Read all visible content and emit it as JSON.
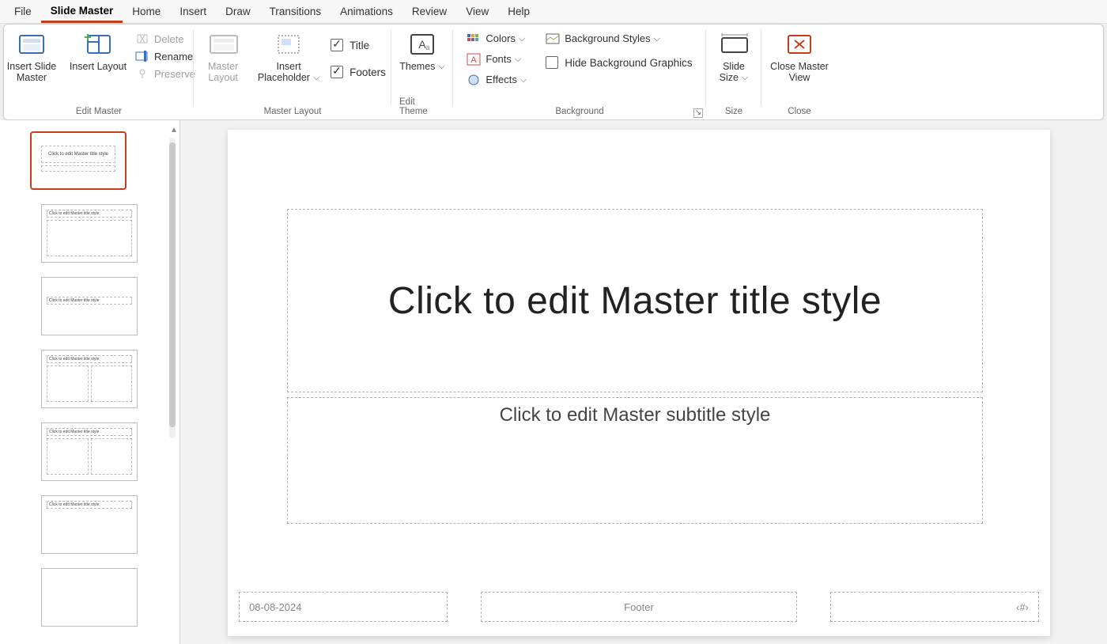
{
  "menubar": {
    "tabs": [
      "File",
      "Slide Master",
      "Home",
      "Insert",
      "Draw",
      "Transitions",
      "Animations",
      "Review",
      "View",
      "Help"
    ],
    "active": "Slide Master"
  },
  "ribbon": {
    "groups": {
      "edit_master": {
        "label": "Edit Master",
        "insert_slide_master": "Insert Slide Master",
        "insert_layout": "Insert Layout",
        "delete": "Delete",
        "rename": "Rename",
        "preserve": "Preserve"
      },
      "master_layout": {
        "label": "Master Layout",
        "master_layout_btn": "Master Layout",
        "insert_placeholder": "Insert Placeholder",
        "title_chk": "Title",
        "footers_chk": "Footers"
      },
      "edit_theme": {
        "label": "Edit Theme",
        "themes_btn": "Themes"
      },
      "background": {
        "label": "Background",
        "colors": "Colors",
        "fonts": "Fonts",
        "effects": "Effects",
        "bg_styles": "Background Styles",
        "hide_bg": "Hide Background Graphics"
      },
      "size": {
        "label": "Size",
        "slide_size": "Slide Size"
      },
      "close": {
        "label": "Close",
        "close_master": "Close Master View"
      }
    }
  },
  "slide": {
    "title_placeholder": "Click to edit Master title style",
    "subtitle_placeholder": "Click to edit Master subtitle style",
    "date": "08-08-2024",
    "footer": "Footer",
    "slidenum": "‹#›"
  },
  "thumbnails": {
    "master_text": "Click to edit Master title style",
    "layout_text": "Click to edit Master title style"
  }
}
